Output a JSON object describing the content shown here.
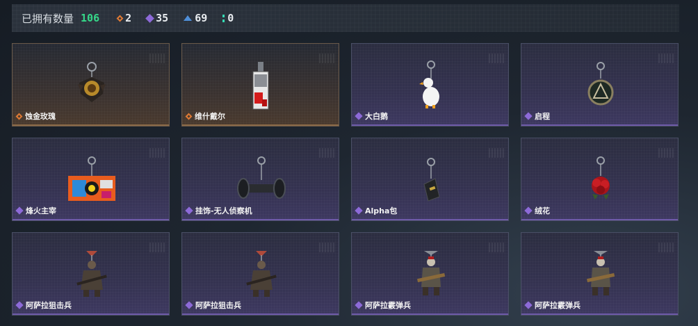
{
  "header": {
    "label": "已拥有数量",
    "total": "106",
    "stats": [
      {
        "icon": "orange-diamond-icon",
        "value": "2",
        "color": "#e07a34"
      },
      {
        "icon": "purple-diamond-icon",
        "value": "35",
        "color": "#8d6ad8"
      },
      {
        "icon": "blue-chevron-icon",
        "value": "69",
        "color": "#4f8fd8"
      },
      {
        "icon": "green-dots-icon",
        "value": "0",
        "color": "#36d9b3"
      }
    ]
  },
  "items": [
    {
      "name": "蚀金玫瑰",
      "rarity": "orange",
      "art": "gold-rose-charm"
    },
    {
      "name": "维什戴尔",
      "rarity": "orange",
      "art": "card-tag-charm"
    },
    {
      "name": "大白鹅",
      "rarity": "purple",
      "art": "white-goose-charm"
    },
    {
      "name": "启程",
      "rarity": "purple",
      "art": "emblem-charm"
    },
    {
      "name": "烽火主宰",
      "rarity": "purple",
      "art": "graffiti-container-charm"
    },
    {
      "name": "挂饰-无人侦察机",
      "rarity": "purple",
      "art": "drone-charm"
    },
    {
      "name": "Alpha包",
      "rarity": "purple",
      "art": "alpha-bag-charm"
    },
    {
      "name": "绒花",
      "rarity": "purple",
      "art": "red-flower-charm"
    },
    {
      "name": "阿萨拉狙击兵",
      "rarity": "purple",
      "art": "sniper-figure-charm"
    },
    {
      "name": "阿萨拉狙击兵",
      "rarity": "purple",
      "art": "sniper-figure-charm"
    },
    {
      "name": "阿萨拉霰弹兵",
      "rarity": "purple",
      "art": "shotgunner-figure-charm"
    },
    {
      "name": "阿萨拉霰弹兵",
      "rarity": "purple",
      "art": "shotgunner-figure-charm"
    }
  ]
}
